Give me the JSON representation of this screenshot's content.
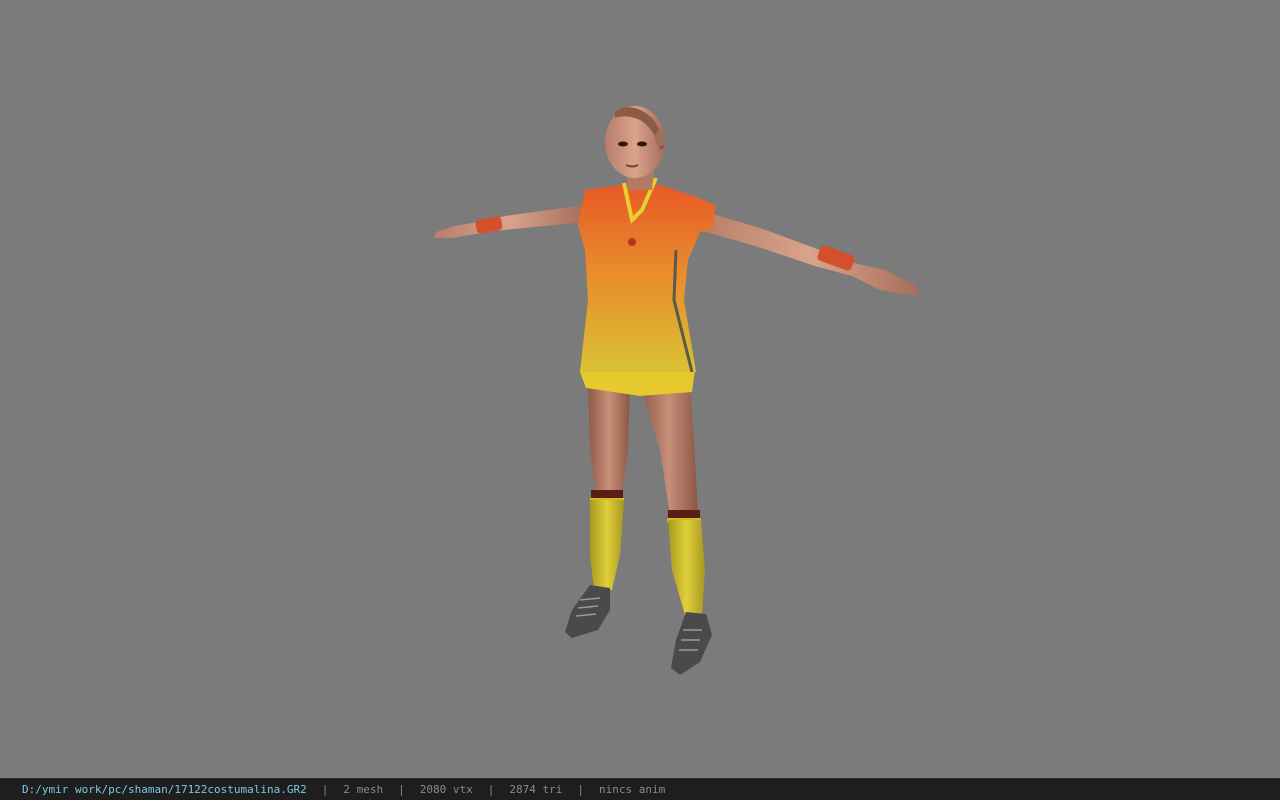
{
  "viewport": {
    "background": "#7b7b7b",
    "model": "character-model"
  },
  "statusbar": {
    "file_path": "D:/ymir work/pc/shaman/17122costumalina.GR2",
    "separator": "|",
    "mesh_count": "2 mesh",
    "vertex_count": "2080 vtx",
    "triangle_count": "2874 tri",
    "animation": "nincs anim",
    "path_color": "#7ec8e3",
    "text_color": "#8a8a8a"
  }
}
